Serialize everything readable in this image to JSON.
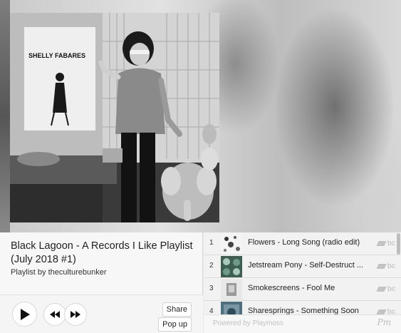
{
  "playlist": {
    "title": "Black Lagoon - A Records I Like Playlist (July 2018 #1)",
    "byline": "Playlist by theculturebunker"
  },
  "cover": {
    "poster_text": "SHELLY FABARES"
  },
  "controls": {
    "share_label": "Share",
    "popup_label": "Pop up",
    "play_icon": "play-icon",
    "prev_icon": "previous-icon",
    "next_icon": "next-icon"
  },
  "tracks": [
    {
      "number": "1",
      "title": "Flowers - Long Song (radio edit)",
      "source": "bc"
    },
    {
      "number": "2",
      "title": "Jetstream Pony - Self-Destruct ...",
      "source": "bc"
    },
    {
      "number": "3",
      "title": "Smokescreens - Fool Me",
      "source": "bc"
    },
    {
      "number": "4",
      "title": "Sharesprings - Something Soon",
      "source": "bc"
    }
  ],
  "footer": {
    "powered_by": "Powered by Playmoss",
    "logo_text": "Pm"
  },
  "colors": {
    "panel_bg": "#f7f7f7",
    "tracklist_bg": "#f2f2f2",
    "muted": "#b9b9b9"
  }
}
